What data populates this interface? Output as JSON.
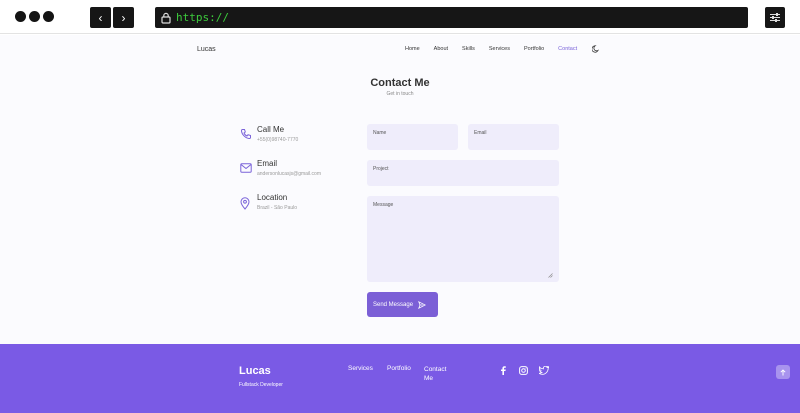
{
  "browser": {
    "url": "https://",
    "back_glyph": "‹",
    "forward_glyph": "›"
  },
  "nav": {
    "logo": "Lucas",
    "links": [
      {
        "label": "Home",
        "active": false
      },
      {
        "label": "About",
        "active": false
      },
      {
        "label": "Skills",
        "active": false
      },
      {
        "label": "Services",
        "active": false
      },
      {
        "label": "Portfolio",
        "active": false
      },
      {
        "label": "Contact",
        "active": true
      }
    ],
    "theme_icon": "moon-icon"
  },
  "contact": {
    "title": "Contact Me",
    "subtitle": "Get in touch",
    "info": [
      {
        "icon": "phone-icon",
        "label": "Call Me",
        "value": "+55(0)98740-7770"
      },
      {
        "icon": "mail-icon",
        "label": "Email",
        "value": "andersonlucasjs@gmail.com"
      },
      {
        "icon": "location-icon",
        "label": "Location",
        "value": "Brazil - São Paulo"
      }
    ],
    "form": {
      "name_placeholder": "Name",
      "email_placeholder": "Email",
      "project_placeholder": "Project",
      "message_placeholder": "Message",
      "send_label": "Send Message"
    }
  },
  "footer": {
    "logo": "Lucas",
    "tagline": "Fullstack Developer",
    "links": [
      "Services",
      "Portfolio",
      "Contact Me"
    ],
    "social_icons": [
      "facebook-icon",
      "instagram-icon",
      "twitter-icon"
    ]
  },
  "colors": {
    "accent": "#7b5fd6",
    "footer_bg": "#7a5ae5",
    "field_bg": "#efedfb",
    "page_bg": "#fbfbfe"
  }
}
